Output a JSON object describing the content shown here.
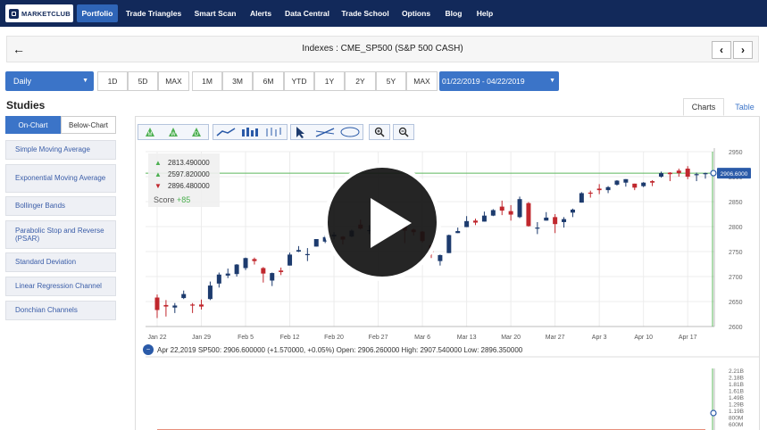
{
  "nav": {
    "logo": "MARKETCLUB",
    "items": [
      {
        "label": "Portfolio",
        "active": true
      },
      {
        "label": "Trade Triangles",
        "active": false
      },
      {
        "label": "Smart Scan",
        "active": false
      },
      {
        "label": "Alerts",
        "active": false
      },
      {
        "label": "Data Central",
        "active": false
      },
      {
        "label": "Trade School",
        "active": false
      },
      {
        "label": "Options",
        "active": false
      },
      {
        "label": "Blog",
        "active": false
      },
      {
        "label": "Help",
        "active": false
      }
    ]
  },
  "header": {
    "back_icon": "arrow-left-icon",
    "title": "Indexes : CME_SP500 (S&P 500 CASH)",
    "prev_icon": "chevron-left-icon",
    "next_icon": "chevron-right-icon"
  },
  "controls": {
    "period": "Daily",
    "ranges": [
      "1D",
      "5D",
      "MAX",
      "1M",
      "3M",
      "6M",
      "YTD",
      "1Y",
      "2Y",
      "5Y",
      "MAX"
    ],
    "date_range": "01/22/2019 - 04/22/2019"
  },
  "studies": {
    "title": "Studies",
    "tabs": [
      "On-Chart",
      "Below-Chart"
    ],
    "items": [
      "Simple Moving Average",
      "Exponential Moving Average",
      "Bollinger Bands",
      "Parabolic Stop and Reverse (PSAR)",
      "Standard Deviation",
      "Linear Regression Channel",
      "Donchian Channels"
    ]
  },
  "chart_tabs": [
    "Charts",
    "Table"
  ],
  "legend": {
    "rows": [
      {
        "icon": "triangle-up-icon",
        "label": "M",
        "value": "2813.490000"
      },
      {
        "icon": "triangle-up-icon",
        "label": "W",
        "value": "2597.820000"
      },
      {
        "icon": "triangle-down-icon",
        "label": "D",
        "value": "2896.480000"
      }
    ],
    "score_label": "Score",
    "score_value": "+85"
  },
  "info_line": "Apr 22,2019 SP500: 2906.600000 (+1.570000, +0.05%) Open: 2906.260000 High: 2907.540000 Low: 2896.350000",
  "colors": {
    "up": "#1d3b6e",
    "down": "#c0272d",
    "nav": "#12295a",
    "accent": "#3b74c8",
    "price_line": "#5cb85c",
    "volume": "#3a8aab",
    "volume_ma": "#d94a2a"
  },
  "chart_data": [
    {
      "type": "candlestick",
      "x_tick_labels": [
        "Jan 22",
        "Jan 29",
        "Feb 5",
        "Feb 12",
        "Feb 20",
        "Feb 27",
        "Mar 6",
        "Mar 13",
        "Mar 20",
        "Mar 27",
        "Apr 3",
        "Apr 10",
        "Apr 17"
      ],
      "y_tick_labels": [
        "2950",
        "2900",
        "2850",
        "2800",
        "2750",
        "2700",
        "2650",
        "2600"
      ],
      "ylim": [
        2600,
        2950
      ],
      "last_price_label": "2906.6000",
      "candles": [
        {
          "date": "Jan 22",
          "o": 2658,
          "h": 2664,
          "l": 2617,
          "c": 2633
        },
        {
          "date": "Jan 23",
          "o": 2643,
          "h": 2653,
          "l": 2620,
          "c": 2640
        },
        {
          "date": "Jan 24",
          "o": 2638,
          "h": 2647,
          "l": 2627,
          "c": 2642
        },
        {
          "date": "Jan 25",
          "o": 2657,
          "h": 2672,
          "l": 2655,
          "c": 2665
        },
        {
          "date": "Jan 28",
          "o": 2644,
          "h": 2647,
          "l": 2627,
          "c": 2643
        },
        {
          "date": "Jan 29",
          "o": 2644,
          "h": 2654,
          "l": 2634,
          "c": 2640
        },
        {
          "date": "Jan 30",
          "o": 2655,
          "h": 2690,
          "l": 2653,
          "c": 2682
        },
        {
          "date": "Jan 31",
          "o": 2686,
          "h": 2708,
          "l": 2678,
          "c": 2704
        },
        {
          "date": "Feb 1",
          "o": 2702,
          "h": 2716,
          "l": 2697,
          "c": 2706
        },
        {
          "date": "Feb 4",
          "o": 2705,
          "h": 2725,
          "l": 2700,
          "c": 2724
        },
        {
          "date": "Feb 5",
          "o": 2717,
          "h": 2738,
          "l": 2713,
          "c": 2737
        },
        {
          "date": "Feb 6",
          "o": 2735,
          "h": 2738,
          "l": 2724,
          "c": 2731
        },
        {
          "date": "Feb 7",
          "o": 2717,
          "h": 2719,
          "l": 2688,
          "c": 2706
        },
        {
          "date": "Feb 8",
          "o": 2692,
          "h": 2708,
          "l": 2681,
          "c": 2707
        },
        {
          "date": "Feb 11",
          "o": 2712,
          "h": 2718,
          "l": 2703,
          "c": 2709
        },
        {
          "date": "Feb 12",
          "o": 2722,
          "h": 2748,
          "l": 2722,
          "c": 2744
        },
        {
          "date": "Feb 13",
          "o": 2750,
          "h": 2761,
          "l": 2749,
          "c": 2753
        },
        {
          "date": "Feb 14",
          "o": 2743,
          "h": 2757,
          "l": 2731,
          "c": 2745
        },
        {
          "date": "Feb 15",
          "o": 2760,
          "h": 2775,
          "l": 2760,
          "c": 2775
        },
        {
          "date": "Feb 19",
          "o": 2770,
          "h": 2787,
          "l": 2767,
          "c": 2779
        },
        {
          "date": "Feb 20",
          "o": 2780,
          "h": 2789,
          "l": 2774,
          "c": 2784
        },
        {
          "date": "Feb 21",
          "o": 2780,
          "h": 2781,
          "l": 2764,
          "c": 2774
        },
        {
          "date": "Feb 22",
          "o": 2780,
          "h": 2794,
          "l": 2779,
          "c": 2792
        },
        {
          "date": "Feb 25",
          "o": 2804,
          "h": 2814,
          "l": 2794,
          "c": 2796
        },
        {
          "date": "Feb 26",
          "o": 2792,
          "h": 2803,
          "l": 2785,
          "c": 2793
        },
        {
          "date": "Feb 27",
          "o": 2787,
          "h": 2795,
          "l": 2775,
          "c": 2792
        },
        {
          "date": "Feb 28",
          "o": 2788,
          "h": 2793,
          "l": 2782,
          "c": 2784
        },
        {
          "date": "Mar 1",
          "o": 2798,
          "h": 2808,
          "l": 2787,
          "c": 2803
        },
        {
          "date": "Mar 4",
          "o": 2814,
          "h": 2817,
          "l": 2767,
          "c": 2792
        },
        {
          "date": "Mar 5",
          "o": 2794,
          "h": 2796,
          "l": 2782,
          "c": 2789
        },
        {
          "date": "Mar 6",
          "o": 2790,
          "h": 2791,
          "l": 2768,
          "c": 2771
        },
        {
          "date": "Mar 7",
          "o": 2763,
          "h": 2764,
          "l": 2737,
          "c": 2749
        },
        {
          "date": "Mar 8",
          "o": 2731,
          "h": 2744,
          "l": 2722,
          "c": 2743
        },
        {
          "date": "Mar 11",
          "o": 2747,
          "h": 2784,
          "l": 2747,
          "c": 2783
        },
        {
          "date": "Mar 12",
          "o": 2787,
          "h": 2798,
          "l": 2787,
          "c": 2791
        },
        {
          "date": "Mar 13",
          "o": 2799,
          "h": 2821,
          "l": 2799,
          "c": 2811
        },
        {
          "date": "Mar 14",
          "o": 2812,
          "h": 2816,
          "l": 2803,
          "c": 2808
        },
        {
          "date": "Mar 15",
          "o": 2810,
          "h": 2830,
          "l": 2810,
          "c": 2822
        },
        {
          "date": "Mar 18",
          "o": 2822,
          "h": 2835,
          "l": 2821,
          "c": 2833
        },
        {
          "date": "Mar 19",
          "o": 2840,
          "h": 2852,
          "l": 2823,
          "c": 2832
        },
        {
          "date": "Mar 20",
          "o": 2831,
          "h": 2843,
          "l": 2812,
          "c": 2824
        },
        {
          "date": "Mar 21",
          "o": 2819,
          "h": 2860,
          "l": 2817,
          "c": 2855
        },
        {
          "date": "Mar 22",
          "o": 2847,
          "h": 2849,
          "l": 2800,
          "c": 2801
        },
        {
          "date": "Mar 25",
          "o": 2796,
          "h": 2809,
          "l": 2785,
          "c": 2798
        },
        {
          "date": "Mar 26",
          "o": 2812,
          "h": 2829,
          "l": 2812,
          "c": 2818
        },
        {
          "date": "Mar 27",
          "o": 2819,
          "h": 2825,
          "l": 2787,
          "c": 2805
        },
        {
          "date": "Mar 28",
          "o": 2809,
          "h": 2819,
          "l": 2798,
          "c": 2815
        },
        {
          "date": "Mar 29",
          "o": 2828,
          "h": 2836,
          "l": 2819,
          "c": 2834
        },
        {
          "date": "Apr 1",
          "o": 2848,
          "h": 2869,
          "l": 2848,
          "c": 2867
        },
        {
          "date": "Apr 2",
          "o": 2868,
          "h": 2872,
          "l": 2858,
          "c": 2867
        },
        {
          "date": "Apr 3",
          "o": 2876,
          "h": 2885,
          "l": 2865,
          "c": 2873
        },
        {
          "date": "Apr 4",
          "o": 2873,
          "h": 2881,
          "l": 2867,
          "c": 2879
        },
        {
          "date": "Apr 5",
          "o": 2884,
          "h": 2893,
          "l": 2882,
          "c": 2892
        },
        {
          "date": "Apr 8",
          "o": 2888,
          "h": 2895,
          "l": 2880,
          "c": 2895
        },
        {
          "date": "Apr 9",
          "o": 2886,
          "h": 2886,
          "l": 2873,
          "c": 2878
        },
        {
          "date": "Apr 10",
          "o": 2881,
          "h": 2889,
          "l": 2879,
          "c": 2888
        },
        {
          "date": "Apr 11",
          "o": 2891,
          "h": 2893,
          "l": 2881,
          "c": 2888
        },
        {
          "date": "Apr 12",
          "o": 2900,
          "h": 2910,
          "l": 2898,
          "c": 2907
        },
        {
          "date": "Apr 15",
          "o": 2908,
          "h": 2909,
          "l": 2891,
          "c": 2905
        },
        {
          "date": "Apr 16",
          "o": 2912,
          "h": 2916,
          "l": 2900,
          "c": 2907
        },
        {
          "date": "Apr 17",
          "o": 2916,
          "h": 2921,
          "l": 2895,
          "c": 2900
        },
        {
          "date": "Apr 18",
          "o": 2904,
          "h": 2908,
          "l": 2891,
          "c": 2905
        },
        {
          "date": "Apr 22",
          "o": 2906,
          "h": 2908,
          "l": 2896,
          "c": 2907
        }
      ]
    },
    {
      "type": "bar",
      "y_tick_labels": [
        "2.21B",
        "2.18B",
        "1.81B",
        "1.61B",
        "1.49B",
        "1.29B",
        "1.19B",
        "800M",
        "600M"
      ],
      "values": [
        0.0,
        0.0,
        0.0,
        0.0,
        0.0,
        0.0,
        0.0,
        0.0,
        0.0,
        0.0,
        0.0,
        0.0,
        0.0,
        0.0,
        0.0,
        0.0,
        0.0,
        0.0,
        0.0,
        0.0,
        0.0,
        0.0,
        0.0,
        0.0,
        0.0,
        0.0,
        0.0,
        0.0,
        0.0,
        0.0,
        0.0,
        0.0,
        0.0,
        0.0,
        0.0,
        0.0,
        0.0,
        0.0,
        0.0,
        0.0,
        0.0,
        0.0,
        0.0,
        0.0,
        0.0,
        0.0,
        0.0,
        0.0,
        0.0,
        0.0,
        0.0,
        0.0,
        0.0,
        0.0,
        0.0,
        0.0,
        0.0,
        0.0,
        0.0,
        0.0,
        0.0,
        0.0,
        0.0
      ]
    }
  ]
}
